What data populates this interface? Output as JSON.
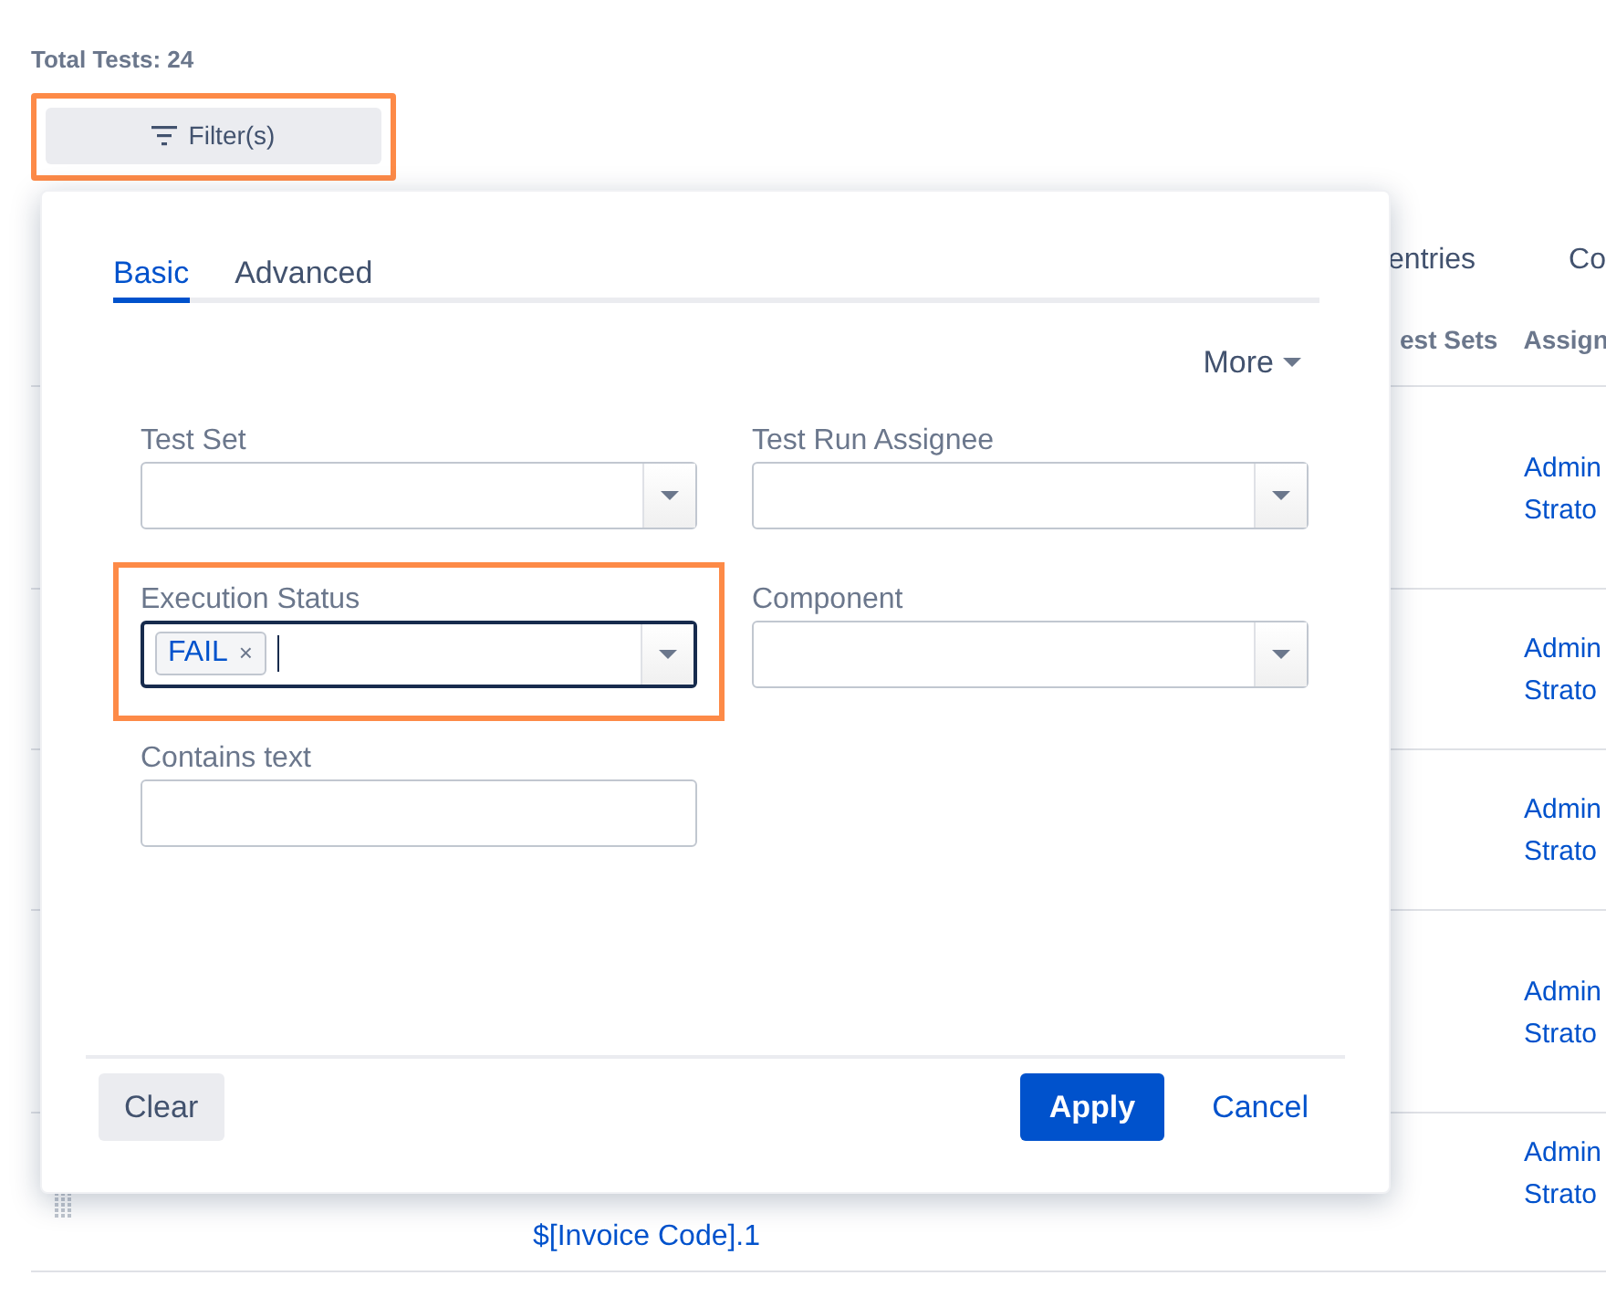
{
  "total_tests": "Total Tests: 24",
  "filter_button": {
    "label": "Filter(s)",
    "highlighted": true
  },
  "table": {
    "toolbar": [
      "entries",
      "Co"
    ],
    "columns": [
      "est Sets",
      "Assign"
    ],
    "rows": [
      {
        "assignee": "Admin Strato"
      },
      {
        "assignee": "Admin Strato"
      },
      {
        "assignee": "Admin Strato"
      },
      {
        "assignee": "Admin Strato"
      },
      {
        "summary": "$[Invoice Code].1",
        "assignee": "Admin Strato"
      }
    ]
  },
  "filter_popup": {
    "tabs": [
      {
        "label": "Basic",
        "selected": true
      },
      {
        "label": "Advanced",
        "selected": false
      }
    ],
    "more": "More",
    "fields": [
      {
        "label": "Test Set",
        "kind": "select",
        "focused": false,
        "highlighted": false
      },
      {
        "label": "Test Run Assignee",
        "kind": "select",
        "focused": false,
        "highlighted": false
      },
      {
        "label": "Execution Status",
        "kind": "select",
        "tags": [
          {
            "label": "FAIL",
            "remove": "×"
          }
        ],
        "focused": true,
        "highlighted": true
      },
      {
        "label": "Component",
        "kind": "select",
        "focused": false,
        "highlighted": false
      },
      {
        "label": "Contains text",
        "kind": "text",
        "focused": false,
        "highlighted": false
      }
    ],
    "buttons": {
      "clear": "Clear",
      "apply": "Apply",
      "cancel": "Cancel"
    }
  }
}
